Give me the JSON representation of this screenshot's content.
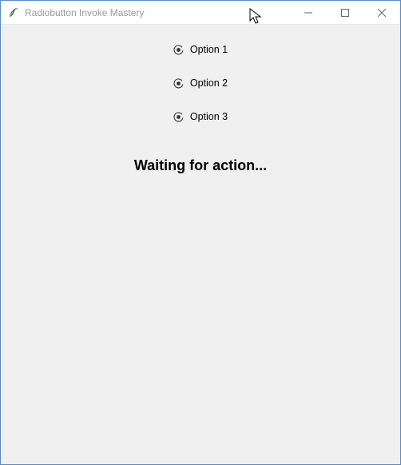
{
  "window": {
    "title": "Radiobutton Invoke Mastery"
  },
  "radios": {
    "items": [
      {
        "label": "Option 1",
        "selected": true
      },
      {
        "label": "Option 2",
        "selected": true
      },
      {
        "label": "Option 3",
        "selected": true
      }
    ]
  },
  "status": {
    "text": "Waiting for action..."
  }
}
